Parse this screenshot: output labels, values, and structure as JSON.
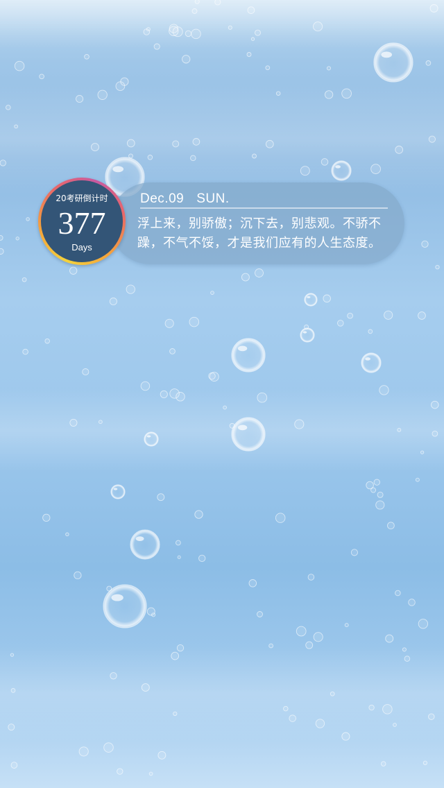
{
  "countdown": {
    "caption": "20考研倒计时",
    "days": "377",
    "unit": "Days"
  },
  "date": {
    "month_day": "Dec.09",
    "weekday": "SUN."
  },
  "quote": {
    "text": "浮上来，别骄傲；沉下去，别悲观。不骄不躁，不气不馁，才是我们应有的人生态度。"
  },
  "colors": {
    "badge_fill": "#335577",
    "ring_gradient": [
      "#f3d23c",
      "#f4a23b",
      "#e8686a",
      "#c85aa0"
    ],
    "panel": "#84a9cb",
    "background": "#9cc7ec",
    "text": "#ffffff"
  },
  "background": {
    "icon": "underwater-bubbles"
  }
}
